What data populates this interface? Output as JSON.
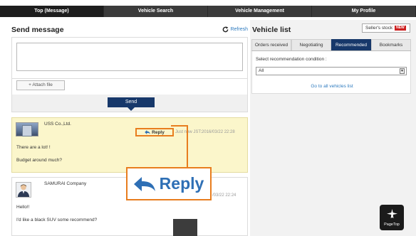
{
  "nav": {
    "items": [
      "Top (Message)",
      "Vehicle Search",
      "Vehicle Management",
      "My Profile"
    ]
  },
  "send_message": {
    "title": "Send message",
    "refresh_label": "Refresh",
    "attach_label": "+ Attach file",
    "send_label": "Send"
  },
  "messages": [
    {
      "sender": "USS Co.,Ltd.",
      "reply_label": "Reply",
      "time": "Just now JST:2016/03/22 22:28",
      "lines": [
        "There are a lot! !",
        "Budget around much?"
      ]
    },
    {
      "sender": "SAMURAI Company",
      "time": "/03/22 22:24",
      "lines": [
        "Hello!!",
        "I'd like a black SUV some recommend?"
      ]
    }
  ],
  "callout": {
    "reply_label": "Reply"
  },
  "vehicle_list": {
    "title": "Vehicle list",
    "sellers_stock_label": "Seller's stock",
    "new_badge": "NEW",
    "tabs": [
      "Orders received",
      "Negotiating",
      "Recommended",
      "Bookmarks"
    ],
    "active_tab": "Recommended",
    "select_label": "Select recommendation condition :",
    "select_value": "All",
    "all_link": "Go to all vehicles list"
  },
  "pagetop": {
    "label": "PageTop"
  },
  "colors": {
    "nav_bg": "#3b3b3b",
    "accent_navy": "#17386a",
    "link_blue": "#2e7bbf",
    "highlight_orange": "#e87d1e",
    "message_yellow": "#fbf6cb"
  }
}
